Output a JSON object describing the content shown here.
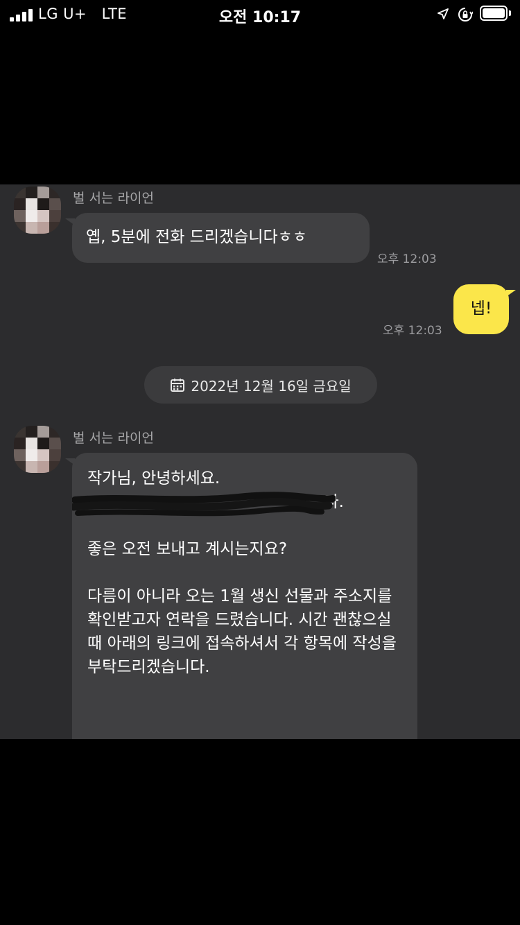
{
  "status_bar": {
    "carrier": "LG U+",
    "network": "LTE",
    "time": "오전 10:17"
  },
  "chat": {
    "messages": [
      {
        "sender": "벌 서는 라이언",
        "text": "옙, 5분에 전화 드리겠습니다ㅎㅎ",
        "time": "오후 12:03"
      },
      {
        "text": "넵!",
        "time": "오후 12:03"
      },
      {
        "date_divider": "2022년 12월 16일 금요일"
      },
      {
        "sender": "벌 서는 라이언",
        "line1": "작가님, 안녕하세요.",
        "line2_visible_end": "다.",
        "body": "좋은 오전 보내고 계시는지요?\n\n다름이 아니라 오는 1월 생신 선물과 주소지를 확인받고자 연락을 드렸습니다. 시간 괜찮으실 때 아래의 링크에 접속하셔서 각 항목에 작성을 부탁드리겠습니다."
      }
    ]
  },
  "colors": {
    "chat_bg": "#2c2c2e",
    "incoming_bubble": "#404042",
    "outgoing_bubble": "#fbe64a",
    "timestamp": "#9c9c9f"
  },
  "icons": [
    "signal-icon",
    "location-arrow-icon",
    "orientation-lock-icon",
    "battery-icon",
    "calendar-icon"
  ]
}
